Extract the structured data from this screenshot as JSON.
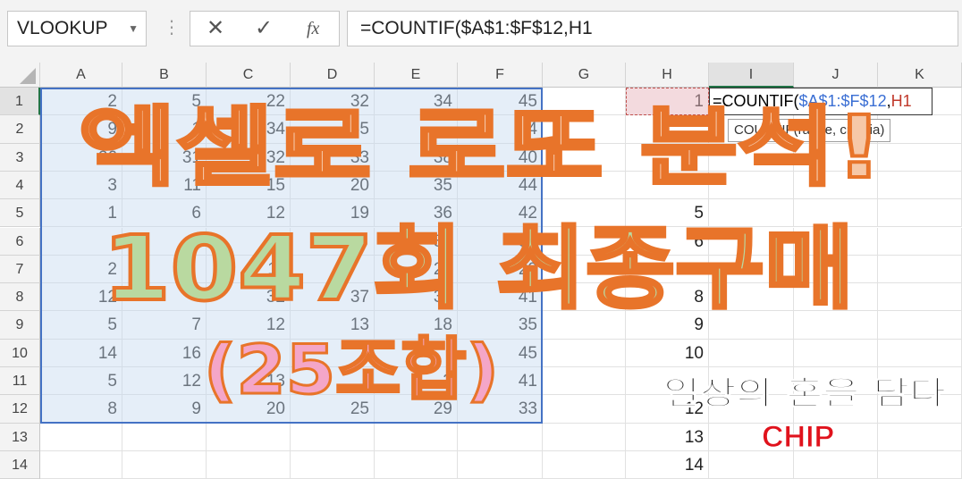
{
  "name_box": {
    "value": "VLOOKUP"
  },
  "formula_bar": {
    "cancel_glyph": "✕",
    "enter_glyph": "✓",
    "fx_label": "fx",
    "formula": "=COUNTIF($A$1:$F$12,H1"
  },
  "columns": [
    "A",
    "B",
    "C",
    "D",
    "E",
    "F",
    "G",
    "H",
    "I",
    "J",
    "K"
  ],
  "rows": [
    "1",
    "2",
    "3",
    "4",
    "5",
    "6",
    "7",
    "8",
    "9",
    "10",
    "11",
    "12",
    "13",
    "14"
  ],
  "table": [
    [
      "2",
      "5",
      "22",
      "32",
      "34",
      "45"
    ],
    [
      "9",
      "1",
      "34",
      "35",
      "",
      "4"
    ],
    [
      "26",
      "31",
      "32",
      "33",
      "38",
      "40"
    ],
    [
      "3",
      "11",
      "15",
      "20",
      "35",
      "44"
    ],
    [
      "1",
      "6",
      "12",
      "19",
      "36",
      "42"
    ],
    [
      "",
      "",
      "22",
      "",
      "35",
      "36"
    ],
    [
      "2",
      "",
      "11",
      "",
      "24",
      "29"
    ],
    [
      "12",
      "",
      "32",
      "37",
      "39",
      "41"
    ],
    [
      "5",
      "7",
      "12",
      "13",
      "18",
      "35"
    ],
    [
      "14",
      "16",
      "",
      "",
      "",
      "45"
    ],
    [
      "5",
      "12",
      "13",
      "",
      "3",
      "41"
    ],
    [
      "8",
      "9",
      "20",
      "25",
      "29",
      "33"
    ]
  ],
  "h_column": [
    "1",
    "",
    "",
    "",
    "5",
    "6",
    "7",
    "8",
    "9",
    "10",
    "",
    "12",
    "13",
    "14"
  ],
  "editing_cell": {
    "prefix": "=COUNTIF(",
    "range": "$A$1:$F$12",
    "sep": ",",
    "ref": "H1"
  },
  "tooltip": {
    "text": "COUNTIF(range, criteria)"
  },
  "overlay": {
    "line1": "엑셀로 로또 분석!",
    "line2": "1047회 최종구매",
    "line3": "(25조합)",
    "tagline": "일상의 혼을 담다",
    "brand": "CHIP"
  },
  "colors": {
    "line1_fill": "#f6c8a8",
    "line1_stroke": "#e8742a",
    "line2_fill": "#b9d9a0",
    "line2_stroke": "#e8742a",
    "line3_fill": "#f4a6c8",
    "line3_stroke": "#e8742a",
    "brand": "#e0121c",
    "selection_border": "#4472c4"
  }
}
